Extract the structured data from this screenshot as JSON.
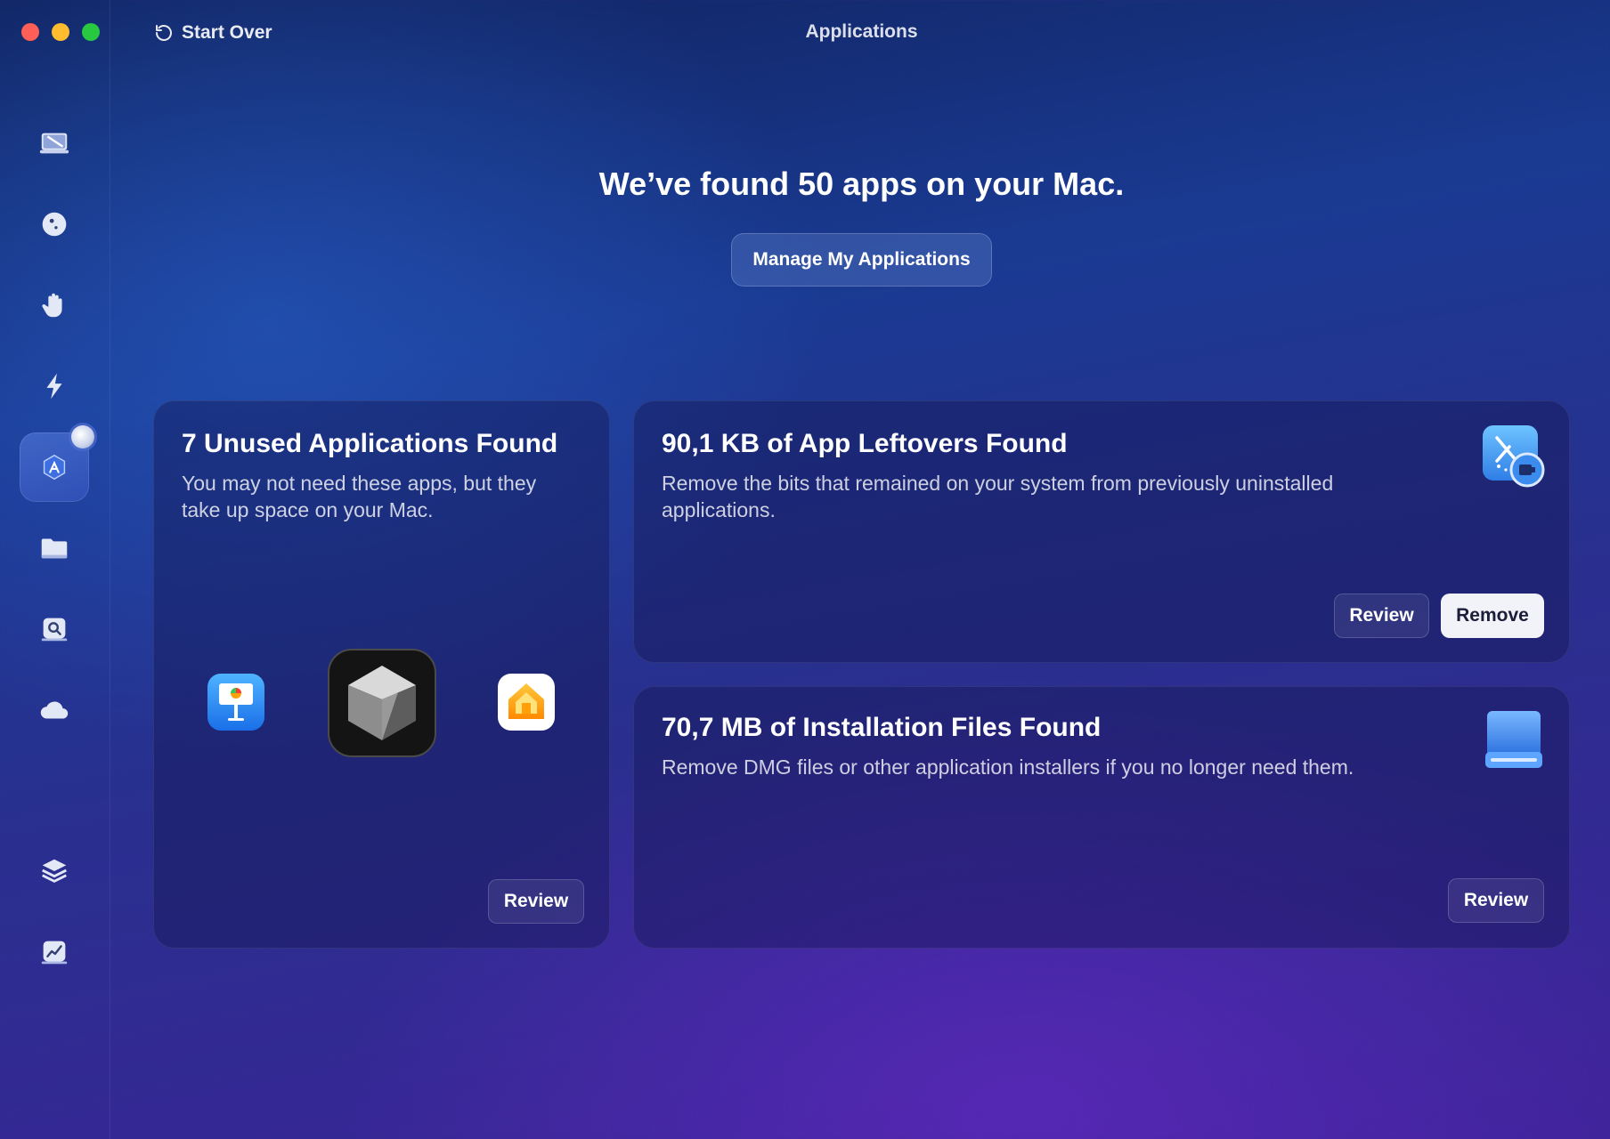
{
  "window": {
    "title": "Applications",
    "start_over_label": "Start Over"
  },
  "sidebar": {
    "items": [
      {
        "icon": "system-junk-icon",
        "active": false
      },
      {
        "icon": "protection-icon",
        "active": false
      },
      {
        "icon": "privacy-hand-icon",
        "active": false
      },
      {
        "icon": "speed-bolt-icon",
        "active": false
      },
      {
        "icon": "applications-icon",
        "active": true
      },
      {
        "icon": "files-folder-icon",
        "active": false
      },
      {
        "icon": "space-lens-icon",
        "active": false
      },
      {
        "icon": "cloud-icon",
        "active": false
      },
      {
        "icon": "stack-icon",
        "active": false
      },
      {
        "icon": "performance-chart-icon",
        "active": false
      }
    ]
  },
  "main": {
    "headline": "We’ve found 50 apps on your Mac.",
    "manage_button": "Manage My Applications"
  },
  "cards": {
    "unused": {
      "title": "7 Unused Applications Found",
      "description_line1": "You may not need these apps, but they",
      "description_line2": "take up space on your Mac.",
      "apps": [
        "keynote-icon",
        "cube-app-icon",
        "home-app-icon"
      ],
      "review_label": "Review"
    },
    "leftovers": {
      "title": "90,1 KB of App Leftovers Found",
      "description_line1": "Remove the bits that remained on your system from previously uninstalled",
      "description_line2": "applications.",
      "icon": "app-leftovers-icon",
      "review_label": "Review",
      "remove_label": "Remove"
    },
    "installers": {
      "title": "70,7 MB of Installation Files Found",
      "description_line1": "Remove DMG files or other application installers if you no longer need them.",
      "icon": "installer-drive-icon",
      "review_label": "Review"
    }
  },
  "colors": {
    "close": "#ff5f57",
    "minimize": "#febc2e",
    "zoom": "#28c840",
    "remove_button": "#f2f3f8"
  }
}
